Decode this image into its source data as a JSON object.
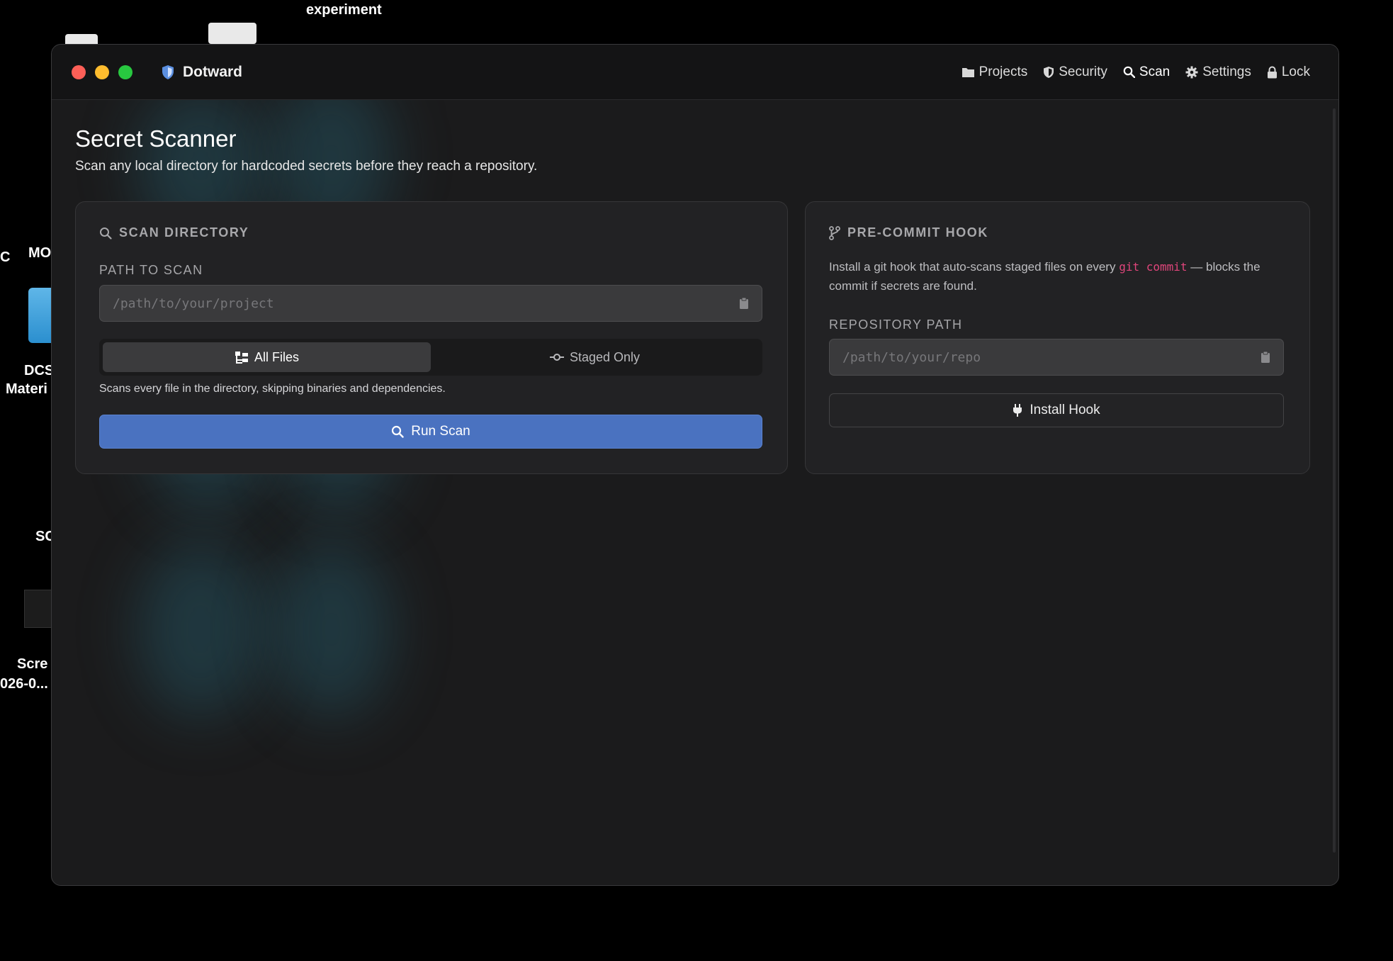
{
  "desktop": {
    "labels": [
      "experiment",
      "C",
      "MO",
      "DCS",
      "Materi",
      "SC",
      "Scre",
      "026-0..."
    ]
  },
  "window": {
    "app_name": "Dotward",
    "nav": [
      {
        "label": "Projects",
        "icon": "folder-icon"
      },
      {
        "label": "Security",
        "icon": "shield-icon"
      },
      {
        "label": "Scan",
        "icon": "search-icon"
      },
      {
        "label": "Settings",
        "icon": "gear-icon"
      },
      {
        "label": "Lock",
        "icon": "lock-icon"
      }
    ]
  },
  "page": {
    "title": "Secret Scanner",
    "subtitle": "Scan any local directory for hardcoded secrets before they reach a repository."
  },
  "scan_card": {
    "heading": "SCAN DIRECTORY",
    "path_label": "PATH TO SCAN",
    "path_placeholder": "/path/to/your/project",
    "modes": [
      "All Files",
      "Staged Only"
    ],
    "active_mode": "All Files",
    "hint": "Scans every file in the directory, skipping binaries and dependencies.",
    "run_label": "Run Scan"
  },
  "hook_card": {
    "heading": "PRE-COMMIT HOOK",
    "desc_before": "Install a git hook that auto-scans staged files on every",
    "desc_code": "git commit",
    "desc_after": "— blocks the commit if secrets are found.",
    "repo_label": "REPOSITORY PATH",
    "repo_placeholder": "/path/to/your/repo",
    "install_label": "Install Hook"
  },
  "colors": {
    "accent": "#4a72c0",
    "code": "#e0457b",
    "close": "#fe5f57",
    "minimize": "#febc2e",
    "maximize": "#28c840"
  }
}
